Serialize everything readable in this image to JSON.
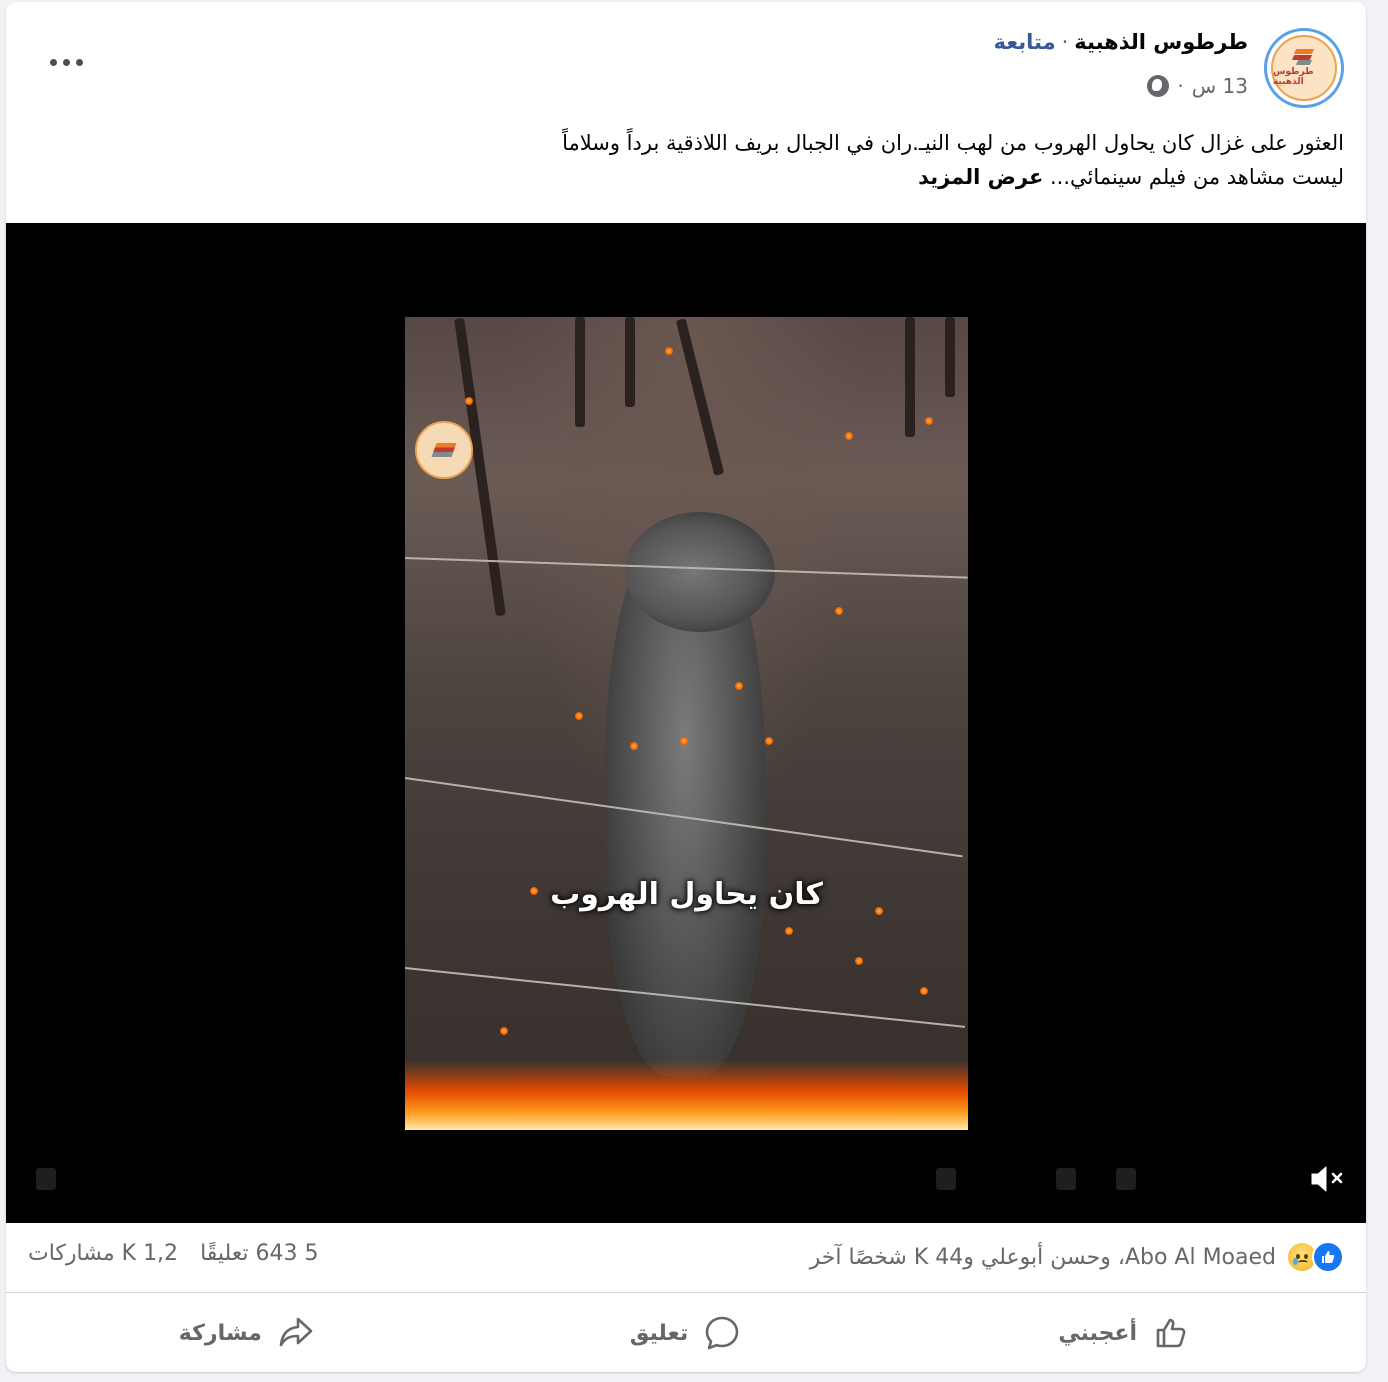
{
  "post": {
    "page_name": "طرطوس الذهبية",
    "follow_label": "متابعة",
    "time_ago": "13 س",
    "privacy_icon": "globe-icon",
    "text_line1": "العثور على غزال كان يحاول الهروب من لهب النيـ.ران في الجبال بريف اللاذقية برداً وسلاماً",
    "text_line2": "ليست مشاهد من فيلم سينمائي...",
    "see_more_label": "عرض المزيد",
    "avatar_label": "طرطوس الذهبية"
  },
  "video": {
    "caption": "كان يحاول الهروب",
    "mute_icon": "muted-speaker-icon"
  },
  "stats": {
    "reaction_icons": [
      "like-icon",
      "sad-icon"
    ],
    "reactors_text": "Abo Al Moaed، وحسن أبوعلي و44 K شخصًا آخر",
    "comments_count": "5 643 تعليقًا",
    "shares_count": "1,2 K مشاركات"
  },
  "actions": {
    "like_label": "أعجبني",
    "comment_label": "تعليق",
    "share_label": "مشاركة"
  },
  "colors": {
    "link": "#385898",
    "secondary_text": "#65676b",
    "like_blue": "#1877f2"
  }
}
